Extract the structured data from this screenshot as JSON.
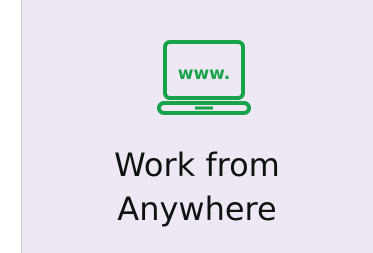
{
  "tile": {
    "icon": "laptop-www-icon",
    "icon_text": "www.",
    "title_line1": "Work from",
    "title_line2": "Anywhere",
    "accent_color": "#16a34a",
    "background_color": "#eee8f5"
  }
}
